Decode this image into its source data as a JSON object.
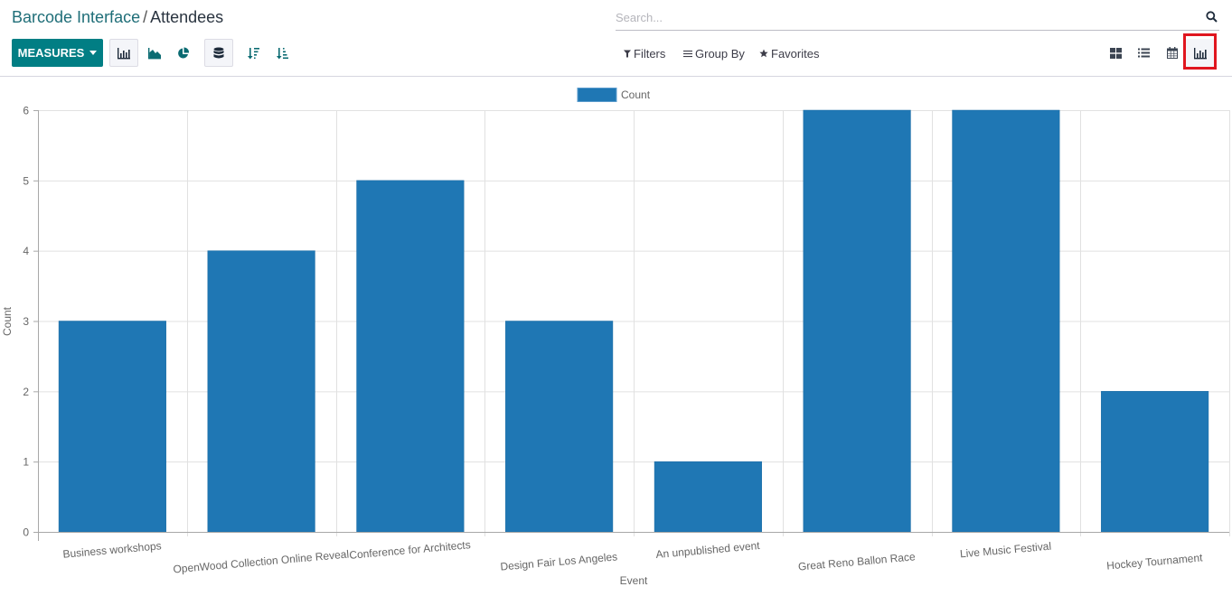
{
  "breadcrumb": {
    "parent": "Barcode Interface",
    "separator": "/",
    "current": "Attendees"
  },
  "toolbar": {
    "measures_label": "MEASURES",
    "chart_types": [
      {
        "name": "bar-chart",
        "icon": "bar-chart-icon",
        "active": true
      },
      {
        "name": "line-chart",
        "icon": "area-chart-icon",
        "active": false
      },
      {
        "name": "pie-chart",
        "icon": "pie-chart-icon",
        "active": false
      }
    ],
    "stacked": {
      "icon": "database-icon",
      "active": true
    },
    "sort_descending": {
      "icon": "sort-amount-desc-icon"
    },
    "sort_ascending": {
      "icon": "sort-amount-asc-icon"
    }
  },
  "search": {
    "placeholder": "Search...",
    "value": ""
  },
  "filters": {
    "filters_label": "Filters",
    "group_by_label": "Group By",
    "favorites_label": "Favorites"
  },
  "views": [
    {
      "name": "kanban",
      "icon": "th-large-icon",
      "active": false
    },
    {
      "name": "list",
      "icon": "list-icon",
      "active": false
    },
    {
      "name": "calendar",
      "icon": "calendar-icon",
      "active": false
    },
    {
      "name": "graph",
      "icon": "bar-chart-icon",
      "active": true
    }
  ],
  "colors": {
    "brand": "#017e84",
    "bar": "#1f77b4",
    "highlight": "#e0161f"
  },
  "chart_data": {
    "type": "bar",
    "title": "",
    "legend": {
      "entries": [
        "Count"
      ],
      "placement": "top-center"
    },
    "categories": [
      "Business workshops",
      "OpenWood Collection Online Reveal",
      "Conference for Architects",
      "Design Fair Los Angeles",
      "An unpublished event",
      "Great Reno Ballon Race",
      "Live Music Festival",
      "Hockey Tournament"
    ],
    "series": [
      {
        "name": "Count",
        "values": [
          3,
          4,
          5,
          3,
          1,
          6,
          6,
          2
        ]
      }
    ],
    "xlabel": "Event",
    "ylabel": "Count",
    "ylim": [
      0,
      6
    ],
    "yticks": [
      "0",
      "1",
      "2",
      "3",
      "4",
      "5",
      "6"
    ],
    "grid": true
  }
}
